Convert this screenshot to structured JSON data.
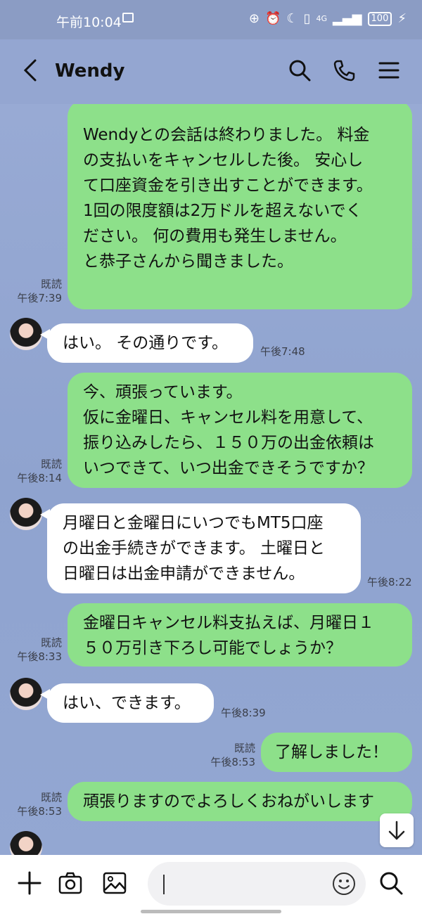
{
  "status_bar": {
    "time": "午前10:04",
    "network": "4G",
    "battery": "100"
  },
  "header": {
    "contact_name": "Wendy"
  },
  "messages": [
    {
      "type": "sent",
      "text": "Wendyとの会話は終わりました。 料金\nの支払いをキャンセルした後。 安心し\nて口座資金を引き出すことができます。\n1回の限度額は2万ドルを超えないでく\nださい。 何の費用も発生しません。\nと恭子さんから聞きました。",
      "read": "既読",
      "time": "午後7:39"
    },
    {
      "type": "received",
      "text": "はい。 その通りです。",
      "time": "午後7:48"
    },
    {
      "type": "sent",
      "text": "今、頑張っています。\n仮に金曜日、キャンセル料を用意して、\n振り込みしたら、１５０万の出金依頼は\nいつできて、いつ出金できそうですか？",
      "read": "既読",
      "time": "午後8:14"
    },
    {
      "type": "received",
      "text": "月曜日と金曜日にいつでもMT5口座\nの出金手続きができます。 土曜日と\n日曜日は出金申請ができません。",
      "time": "午後8:22"
    },
    {
      "type": "sent",
      "text": "金曜日キャンセル料支払えば、月曜日１\n５０万引き下ろし可能でしょうか？",
      "read": "既読",
      "time": "午後8:33"
    },
    {
      "type": "received",
      "text": "はい、できます。",
      "time": "午後8:39"
    },
    {
      "type": "sent",
      "text": "了解しました！",
      "read": "既読",
      "time": "午後8:53"
    },
    {
      "type": "sent",
      "text": "頑張りますのでよろしくおねがいします",
      "read": "既読",
      "time": "午後8:53"
    }
  ],
  "input": {
    "placeholder": ""
  }
}
